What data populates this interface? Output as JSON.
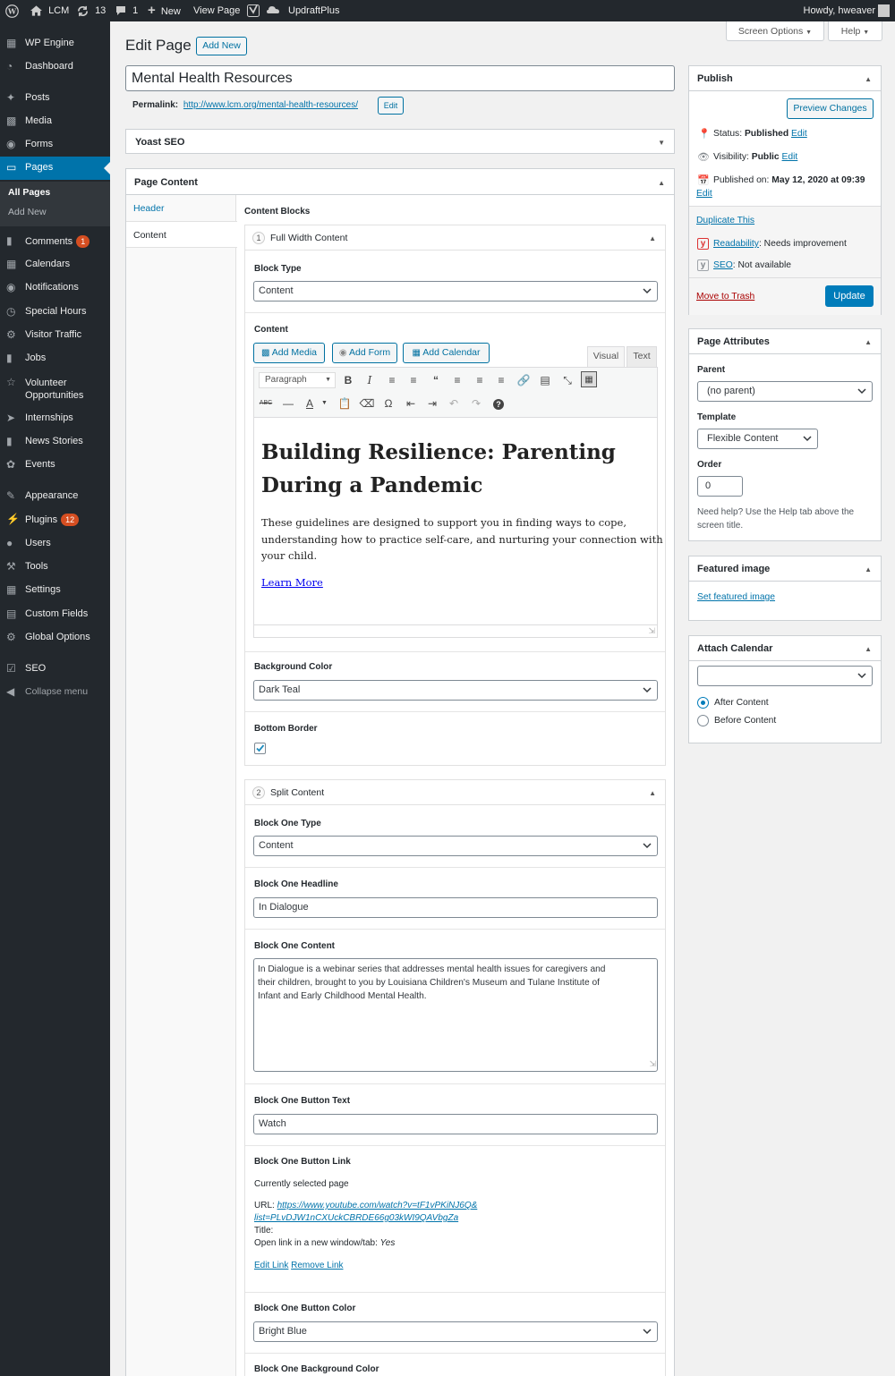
{
  "adminbar": {
    "site_name": "LCM",
    "updates_count": "13",
    "comments_count": "1",
    "new_label": "New",
    "view_page_label": "View Page",
    "updraft_label": "UpdraftPlus",
    "greeting": "Howdy, hweaver"
  },
  "sidebar": {
    "items": [
      {
        "label": "WP Engine",
        "icon": "wp-engine-icon"
      },
      {
        "label": "Dashboard",
        "icon": "dashboard-icon"
      },
      {
        "label": "Posts",
        "icon": "pin-icon"
      },
      {
        "label": "Media",
        "icon": "media-icon"
      },
      {
        "label": "Forms",
        "icon": "forms-icon"
      },
      {
        "label": "Pages",
        "icon": "pages-icon"
      },
      {
        "label": "Comments",
        "icon": "comment-icon",
        "badge": "1"
      },
      {
        "label": "Calendars",
        "icon": "calendar-icon"
      },
      {
        "label": "Notifications",
        "icon": "notifications-icon"
      },
      {
        "label": "Special Hours",
        "icon": "clock-icon"
      },
      {
        "label": "Visitor Traffic",
        "icon": "traffic-icon"
      },
      {
        "label": "Jobs",
        "icon": "briefcase-icon"
      },
      {
        "label": "Volunteer Opportunities",
        "line1": "Volunteer",
        "line2": "Opportunities",
        "icon": "volunteer-icon"
      },
      {
        "label": "Internships",
        "icon": "megaphone-icon"
      },
      {
        "label": "News Stories",
        "icon": "news-icon"
      },
      {
        "label": "Events",
        "icon": "events-icon"
      },
      {
        "label": "Appearance",
        "icon": "brush-icon"
      },
      {
        "label": "Plugins",
        "icon": "plug-icon",
        "badge": "12"
      },
      {
        "label": "Users",
        "icon": "users-icon"
      },
      {
        "label": "Tools",
        "icon": "wrench-icon"
      },
      {
        "label": "Settings",
        "icon": "settings-icon"
      },
      {
        "label": "Custom Fields",
        "icon": "fields-icon"
      },
      {
        "label": "Global Options",
        "icon": "gear-icon"
      },
      {
        "label": "SEO",
        "icon": "yoast-icon"
      },
      {
        "label": "Collapse menu",
        "icon": "collapse-icon"
      }
    ],
    "submenu": [
      "All Pages",
      "Add New"
    ]
  },
  "header": {
    "title": "Edit Page",
    "add_new": "Add New",
    "screen_options": "Screen Options",
    "help": "Help"
  },
  "post": {
    "title": "Mental Health Resources",
    "permalink_label": "Permalink:",
    "permalink_base": "http://www.lcm.org/",
    "permalink_slug": "mental-health-resources",
    "permalink_end": "/",
    "permalink_edit": "Edit"
  },
  "yoast": {
    "title": "Yoast SEO"
  },
  "page_content": {
    "title": "Page Content",
    "tabs": [
      "Header",
      "Content"
    ],
    "blocks_label": "Content Blocks"
  },
  "block1": {
    "number": "1",
    "title": "Full Width Content",
    "block_type_label": "Block Type",
    "block_type_value": "Content",
    "content_label": "Content",
    "add_media": "Add Media",
    "add_form": "Add Form",
    "add_calendar": "Add Calendar",
    "tab_visual": "Visual",
    "tab_text": "Text",
    "format_select": "Paragraph",
    "heading": "Building Resilience: Parenting During a Pandemic",
    "heading_line1": "Building Resilience: Parenting",
    "heading_line2": "During a Pandemic",
    "body": "These guidelines are designed to support you in finding ways to cope, understanding how to practice self-care, and nurturing your connection with your child.",
    "body_line1": "These guidelines are designed to support you in finding ways to cope,",
    "body_line2": "understanding how to practice self-care, and nurturing your connection with",
    "body_line3": "your child.",
    "link_text": "Learn More",
    "bg_color_label": "Background Color",
    "bg_color_value": "Dark Teal",
    "bottom_border_label": "Bottom Border",
    "bottom_border_checked": true
  },
  "block2": {
    "number": "2",
    "title": "Split Content",
    "type_label": "Block One Type",
    "type_value": "Content",
    "headline_label": "Block One Headline",
    "headline_value": "In Dialogue",
    "content_label": "Block One Content",
    "content_value": "In Dialogue is a webinar series that addresses mental health issues for caregivers and their children, brought to you by Louisiana Children's Museum and Tulane Institute of Infant and Early Childhood Mental Health.",
    "content_line1": "In Dialogue is a webinar series that addresses mental health issues for caregivers and",
    "content_line2": "their children, brought to you by Louisiana Children's Museum and Tulane Institute of",
    "content_line3": "Infant and Early Childhood Mental Health.",
    "button_text_label": "Block One Button Text",
    "button_text_value": "Watch",
    "button_link_label": "Block One Button Link",
    "currently_selected": "Currently selected page",
    "url_label": "URL:",
    "url_line1": "https://www.youtube.com/watch?v=tF1vPKiNJ6Q&",
    "url_line2": "list=PLvDJW1nCXUckCBRDE66g03kWI9QAVbgZa",
    "title_label": "Title:",
    "new_window_label": "Open link in a new window/tab:",
    "new_window_value": "Yes",
    "edit_link": "Edit Link",
    "remove_link": "Remove Link",
    "button_color_label": "Block One Button Color",
    "button_color_value": "Bright Blue",
    "bg_color_label": "Block One Background Color"
  },
  "publish": {
    "title": "Publish",
    "preview": "Preview Changes",
    "status_label": "Status:",
    "status_value": "Published",
    "visibility_label": "Visibility:",
    "visibility_value": "Public",
    "published_label": "Published on:",
    "published_value": "May 12, 2020 at 09:39",
    "edit": "Edit",
    "duplicate": "Duplicate This",
    "readability_label": "Readability",
    "readability_value": ": Needs improvement",
    "seo_label": "SEO",
    "seo_value": ": Not available",
    "trash": "Move to Trash",
    "update": "Update"
  },
  "attributes": {
    "title": "Page Attributes",
    "parent_label": "Parent",
    "parent_value": "(no parent)",
    "template_label": "Template",
    "template_value": "Flexible Content",
    "order_label": "Order",
    "order_value": "0",
    "help_line1": "Need help? Use the Help tab above the",
    "help_line2": "screen title."
  },
  "featured": {
    "title": "Featured image",
    "link": "Set featured image"
  },
  "calendar": {
    "title": "Attach Calendar",
    "select_value": "",
    "opt_after": "After Content",
    "opt_before": "Before Content"
  },
  "colors": {
    "accent": "#0073aa",
    "menu_bg": "#23282d",
    "active": "#0073aa",
    "badge": "#d54e21",
    "trash": "#a00"
  }
}
